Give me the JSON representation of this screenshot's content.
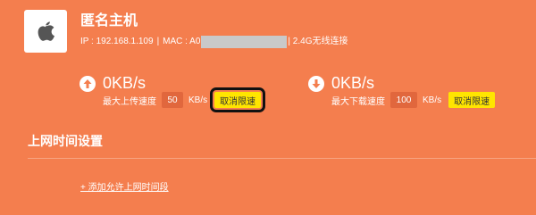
{
  "device": {
    "icon": "apple-icon",
    "name": "匿名主机",
    "ip_label": "IP : 192.168.1.109",
    "separator": "|",
    "mac_label": "MAC : A0",
    "connection": "| 2.4G无线连接"
  },
  "upload": {
    "icon": "arrow-up-circle-icon",
    "speed": "0KB/s",
    "limit_label": "最大上传速度",
    "limit_value": "50",
    "unit": "KB/s",
    "cancel_label": "取消限速"
  },
  "download": {
    "icon": "arrow-down-circle-icon",
    "speed": "0KB/s",
    "limit_label": "最大下载速度",
    "limit_value": "100",
    "unit": "KB/s",
    "cancel_label": "取消限速"
  },
  "schedule": {
    "title": "上网时间设置",
    "add_link": "+ 添加允许上网时间段"
  },
  "colors": {
    "background": "#f47e4e",
    "button": "#ffe500",
    "input": "#e1673d"
  }
}
